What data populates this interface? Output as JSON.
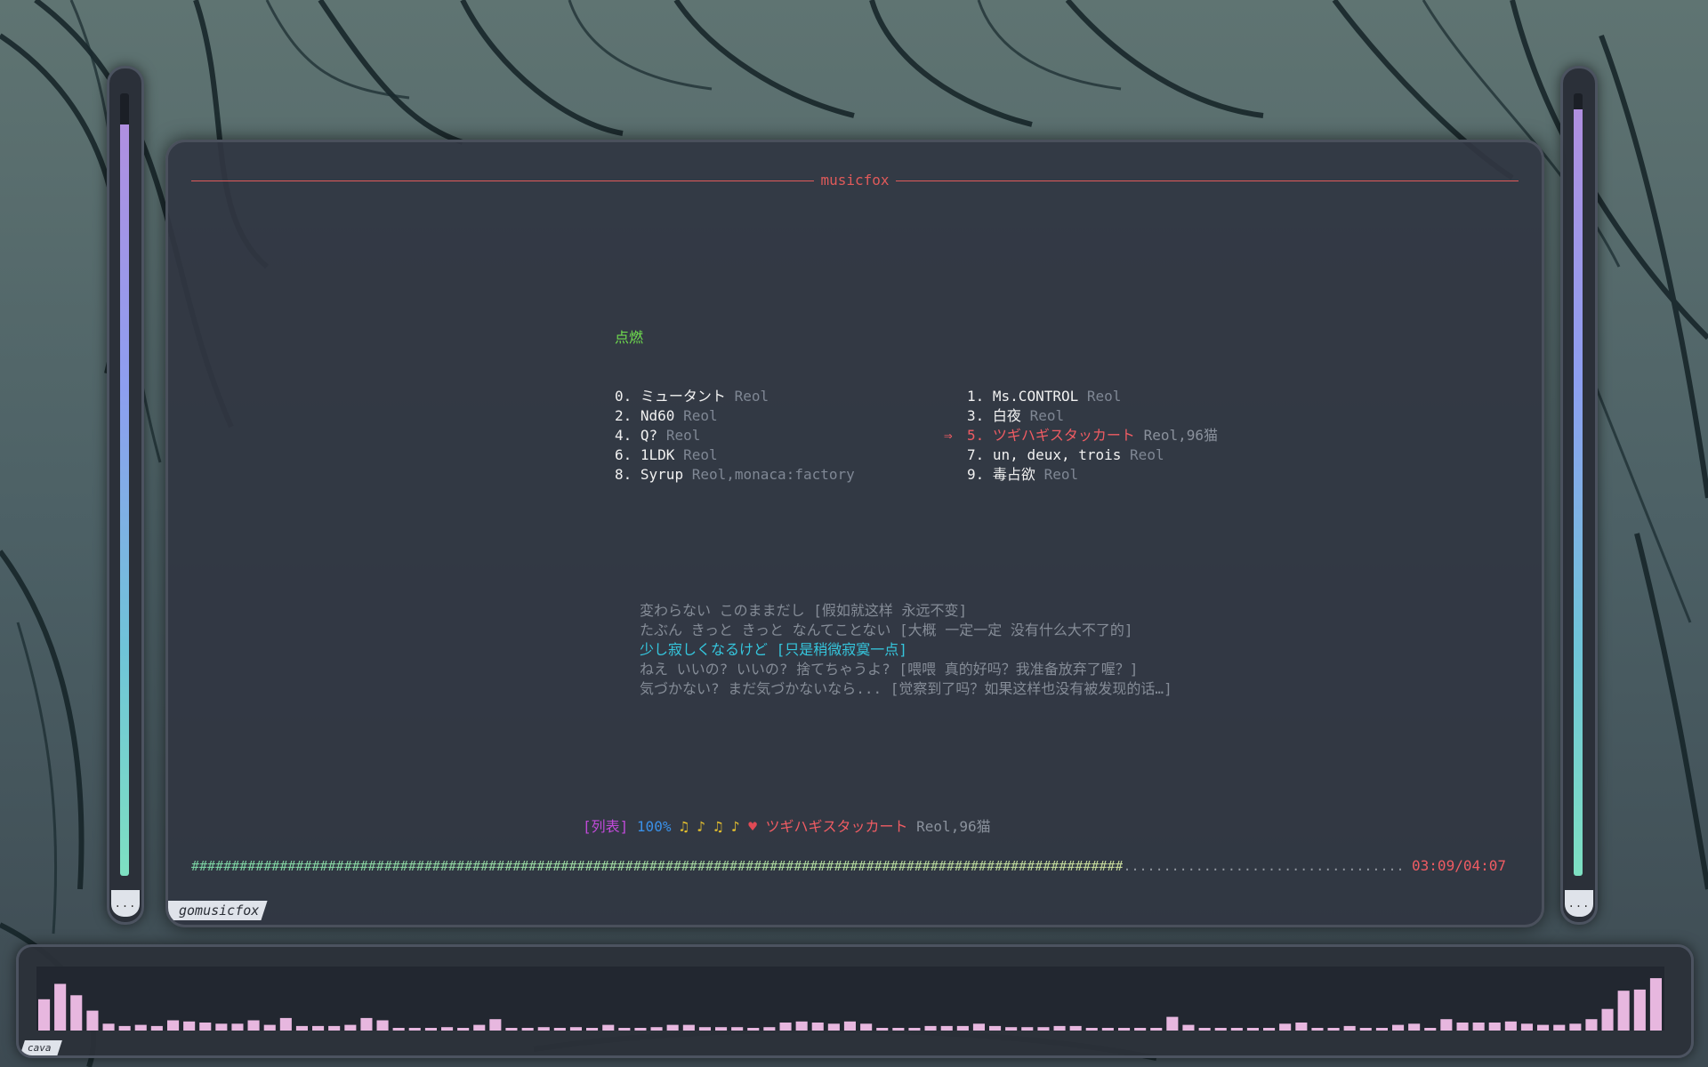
{
  "window": {
    "title": "musicfox",
    "tab_label": "gomusicfox"
  },
  "menu": {
    "title": "点燃",
    "songs": [
      {
        "index": "0.",
        "name": "ミュータント",
        "artist": "Reol"
      },
      {
        "index": "1.",
        "name": "Ms.CONTROL",
        "artist": "Reol"
      },
      {
        "index": "2.",
        "name": "Nd60",
        "artist": "Reol"
      },
      {
        "index": "3.",
        "name": "白夜",
        "artist": "Reol"
      },
      {
        "index": "4.",
        "name": "Q?",
        "artist": "Reol"
      },
      {
        "index": "5.",
        "name": "ツギハギスタッカート",
        "artist": "Reol,96猫"
      },
      {
        "index": "6.",
        "name": "1LDK",
        "artist": "Reol"
      },
      {
        "index": "7.",
        "name": "un, deux, trois",
        "artist": "Reol"
      },
      {
        "index": "8.",
        "name": "Syrup",
        "artist": "Reol,monaca:factory"
      },
      {
        "index": "9.",
        "name": "毒占欲",
        "artist": "Reol"
      }
    ],
    "selected_index": 5,
    "cursor": "⇒"
  },
  "lyrics": [
    {
      "text": "変わらない このままだし [假如就这样 永远不变]",
      "current": false
    },
    {
      "text": "たぶん きっと きっと なんてことない [大概 一定一定 没有什么大不了的]",
      "current": false
    },
    {
      "text": "少し寂しくなるけど [只是稍微寂寞一点]",
      "current": true
    },
    {
      "text": "ねえ いいの? いいの? 捨てちゃうよ? [喂喂 真的好吗？我准备放弃了喔？]",
      "current": false
    },
    {
      "text": "気づかない? まだ気づかないなら... [觉察到了吗？如果这样也没有被发现的话…]",
      "current": false
    }
  ],
  "status": {
    "mode": "[列表]",
    "volume": "100%",
    "notes": [
      "♫",
      "♪",
      "♫",
      "♪"
    ],
    "heart": "♥",
    "song": "ツギハギスタッカート",
    "artist": "Reol,96猫"
  },
  "playback": {
    "progress": 0.7711,
    "time": "03:09/04:07"
  },
  "side_meters": {
    "left_level": 0.96,
    "right_level": 0.98,
    "cap_label": "..."
  },
  "cava": {
    "label": "cava",
    "levels": [
      0.55,
      0.82,
      0.62,
      0.35,
      0.12,
      0.08,
      0.1,
      0.08,
      0.18,
      0.16,
      0.14,
      0.12,
      0.12,
      0.18,
      0.1,
      0.22,
      0.08,
      0.08,
      0.08,
      0.1,
      0.22,
      0.18,
      0.04,
      0.04,
      0.04,
      0.06,
      0.04,
      0.1,
      0.2,
      0.04,
      0.04,
      0.06,
      0.04,
      0.06,
      0.04,
      0.1,
      0.04,
      0.04,
      0.06,
      0.1,
      0.1,
      0.06,
      0.06,
      0.06,
      0.04,
      0.06,
      0.14,
      0.16,
      0.14,
      0.12,
      0.16,
      0.12,
      0.04,
      0.04,
      0.04,
      0.08,
      0.08,
      0.08,
      0.12,
      0.08,
      0.06,
      0.06,
      0.06,
      0.08,
      0.08,
      0.04,
      0.04,
      0.04,
      0.04,
      0.04,
      0.24,
      0.1,
      0.04,
      0.04,
      0.04,
      0.04,
      0.04,
      0.12,
      0.14,
      0.04,
      0.04,
      0.08,
      0.04,
      0.04,
      0.1,
      0.12,
      0.04,
      0.2,
      0.14,
      0.14,
      0.14,
      0.16,
      0.12,
      0.1,
      0.1,
      0.12,
      0.2,
      0.38,
      0.7,
      0.72,
      0.92
    ],
    "bar_color": "#e7b7df"
  },
  "colors": {
    "accent_red": "#f05c63",
    "menu_title_green": "#6fdc4e",
    "lyric_current": "#35c6dd"
  }
}
